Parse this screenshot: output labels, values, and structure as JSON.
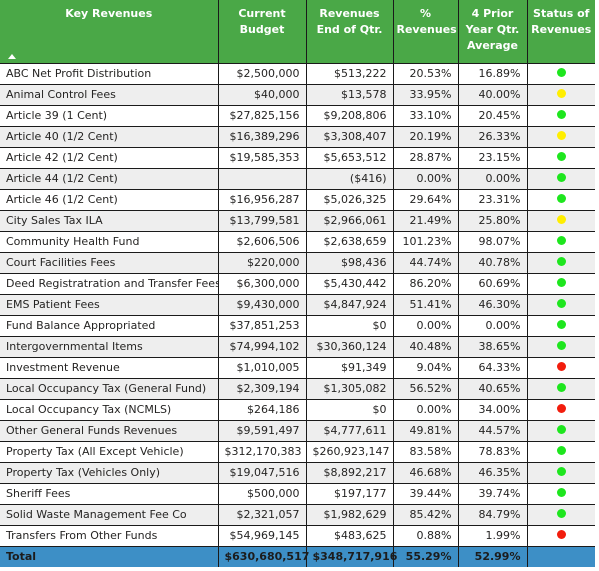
{
  "table": {
    "headers": [
      "Key Revenues",
      "Current Budget",
      "Revenues End of Qtr.",
      "% Revenues",
      "4 Prior Year Qtr. Average",
      "Status of Revenues"
    ],
    "sort": {
      "column": "Key Revenues",
      "direction": "ascending",
      "icon": "triangle-up"
    },
    "status_colors": {
      "green": "#1ee61e",
      "yellow": "#ffee00",
      "red": "#f21d0d"
    },
    "rows": [
      {
        "name": "ABC Net Profit Distribution",
        "budget": "$2,500,000",
        "revenues": "$513,222",
        "pct": "20.53%",
        "prior_avg": "16.89%",
        "status": "green"
      },
      {
        "name": "Animal Control Fees",
        "budget": "$40,000",
        "revenues": "$13,578",
        "pct": "33.95%",
        "prior_avg": "40.00%",
        "status": "yellow"
      },
      {
        "name": "Article 39 (1 Cent)",
        "budget": "$27,825,156",
        "revenues": "$9,208,806",
        "pct": "33.10%",
        "prior_avg": "20.45%",
        "status": "green"
      },
      {
        "name": "Article 40 (1/2 Cent)",
        "budget": "$16,389,296",
        "revenues": "$3,308,407",
        "pct": "20.19%",
        "prior_avg": "26.33%",
        "status": "yellow"
      },
      {
        "name": "Article 42 (1/2 Cent)",
        "budget": "$19,585,353",
        "revenues": "$5,653,512",
        "pct": "28.87%",
        "prior_avg": "23.15%",
        "status": "green"
      },
      {
        "name": "Article 44 (1/2 Cent)",
        "budget": "",
        "revenues": "($416)",
        "pct": "0.00%",
        "prior_avg": "0.00%",
        "status": "green"
      },
      {
        "name": "Article 46 (1/2 Cent)",
        "budget": "$16,956,287",
        "revenues": "$5,026,325",
        "pct": "29.64%",
        "prior_avg": "23.31%",
        "status": "green"
      },
      {
        "name": "City Sales Tax ILA",
        "budget": "$13,799,581",
        "revenues": "$2,966,061",
        "pct": "21.49%",
        "prior_avg": "25.80%",
        "status": "yellow"
      },
      {
        "name": "Community Health Fund",
        "budget": "$2,606,506",
        "revenues": "$2,638,659",
        "pct": "101.23%",
        "prior_avg": "98.07%",
        "status": "green"
      },
      {
        "name": "Court Facilities Fees",
        "budget": "$220,000",
        "revenues": "$98,436",
        "pct": "44.74%",
        "prior_avg": "40.78%",
        "status": "green"
      },
      {
        "name": "Deed Registratration and Transfer Fees",
        "budget": "$6,300,000",
        "revenues": "$5,430,442",
        "pct": "86.20%",
        "prior_avg": "60.69%",
        "status": "green"
      },
      {
        "name": "EMS Patient Fees",
        "budget": "$9,430,000",
        "revenues": "$4,847,924",
        "pct": "51.41%",
        "prior_avg": "46.30%",
        "status": "green"
      },
      {
        "name": "Fund Balance Appropriated",
        "budget": "$37,851,253",
        "revenues": "$0",
        "pct": "0.00%",
        "prior_avg": "0.00%",
        "status": "green"
      },
      {
        "name": "Intergovernmental Items",
        "budget": "$74,994,102",
        "revenues": "$30,360,124",
        "pct": "40.48%",
        "prior_avg": "38.65%",
        "status": "green"
      },
      {
        "name": "Investment Revenue",
        "budget": "$1,010,005",
        "revenues": "$91,349",
        "pct": "9.04%",
        "prior_avg": "64.33%",
        "status": "red"
      },
      {
        "name": "Local Occupancy Tax (General Fund)",
        "budget": "$2,309,194",
        "revenues": "$1,305,082",
        "pct": "56.52%",
        "prior_avg": "40.65%",
        "status": "green"
      },
      {
        "name": "Local Occupancy Tax (NCMLS)",
        "budget": "$264,186",
        "revenues": "$0",
        "pct": "0.00%",
        "prior_avg": "34.00%",
        "status": "red"
      },
      {
        "name": "Other General Funds Revenues",
        "budget": "$9,591,497",
        "revenues": "$4,777,611",
        "pct": "49.81%",
        "prior_avg": "44.57%",
        "status": "green"
      },
      {
        "name": "Property Tax (All Except Vehicle)",
        "budget": "$312,170,383",
        "revenues": "$260,923,147",
        "pct": "83.58%",
        "prior_avg": "78.83%",
        "status": "green"
      },
      {
        "name": "Property Tax (Vehicles Only)",
        "budget": "$19,047,516",
        "revenues": "$8,892,217",
        "pct": "46.68%",
        "prior_avg": "46.35%",
        "status": "green"
      },
      {
        "name": "Sheriff Fees",
        "budget": "$500,000",
        "revenues": "$197,177",
        "pct": "39.44%",
        "prior_avg": "39.74%",
        "status": "green"
      },
      {
        "name": "Solid Waste Management Fee Co",
        "budget": "$2,321,057",
        "revenues": "$1,982,629",
        "pct": "85.42%",
        "prior_avg": "84.79%",
        "status": "green"
      },
      {
        "name": "Transfers From Other Funds",
        "budget": "$54,969,145",
        "revenues": "$483,625",
        "pct": "0.88%",
        "prior_avg": "1.99%",
        "status": "red"
      }
    ],
    "total": {
      "label": "Total",
      "budget": "$630,680,517",
      "revenues": "$348,717,916",
      "pct": "55.29%",
      "prior_avg": "52.99%",
      "status": ""
    }
  }
}
